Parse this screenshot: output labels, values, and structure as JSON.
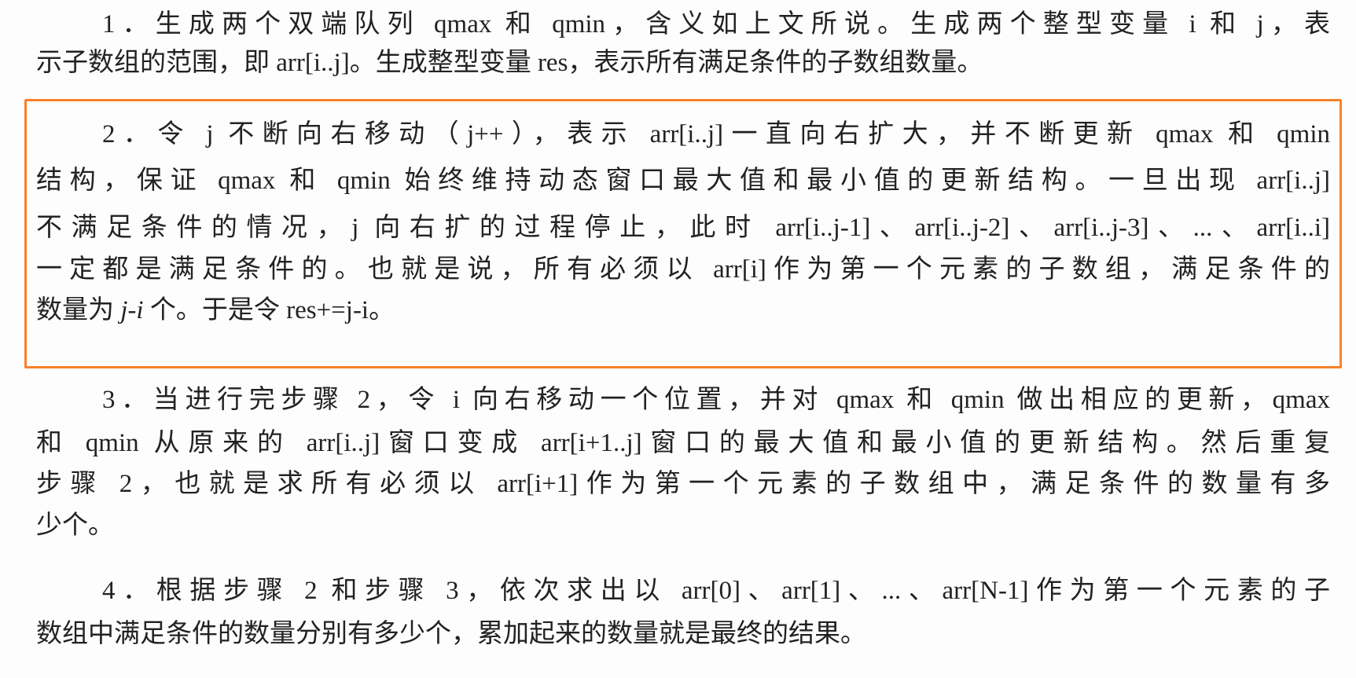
{
  "paragraphs": [
    {
      "lines": [
        "1．生成两个双端队列 qmax 和 qmin，含义如上文所说。生成两个整型变量 i 和 j，表",
        "示子数组的范围，即 arr[i..j]。生成整型变量 res，表示所有满足条件的子数组数量。"
      ]
    },
    {
      "lines": [
        "2．令 j 不断向右移动（j++），表示 arr[i..j]一直向右扩大，并不断更新 qmax 和 qmin",
        "结构，保证 qmax 和 qmin 始终维持动态窗口最大值和最小值的更新结构。一旦出现 arr[i..j]",
        "不满足条件的情况，j 向右扩的过程停止，此时 arr[i..j-1]、arr[i..j-2]、arr[i..j-3]、...、arr[i..i]",
        "一定都是满足条件的。也就是说，所有必须以 arr[i]作为第一个元素的子数组，满足条件的"
      ],
      "last_line": {
        "before": "数量为 ",
        "italic": "j-i",
        "after": " 个。于是令 res+=j-i。"
      },
      "highlight_color": "#f7822a"
    },
    {
      "lines": [
        "3．当进行完步骤 2，令 i 向右移动一个位置，并对 qmax 和 qmin 做出相应的更新，qmax",
        "和 qmin 从原来的 arr[i..j]窗口变成 arr[i+1..j]窗口的最大值和最小值的更新结构。然后重复",
        "步骤 2，也就是求所有必须以 arr[i+1]作为第一个元素的子数组中，满足条件的数量有多",
        "少个。"
      ]
    },
    {
      "lines": [
        "4．根据步骤 2 和步骤 3，依次求出以 arr[0]、arr[1]、...、arr[N-1]作为第一个元素的子",
        "数组中满足条件的数量分别有多少个，累加起来的数量就是最终的结果。"
      ]
    }
  ]
}
